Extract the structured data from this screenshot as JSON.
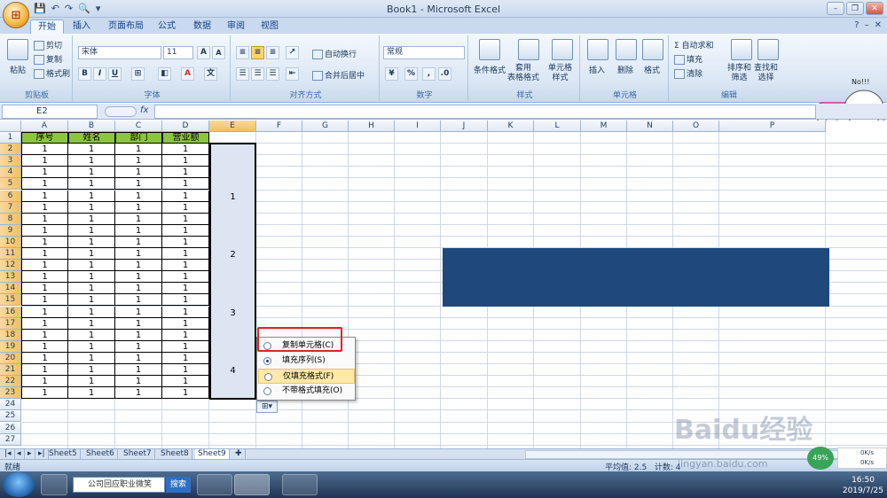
{
  "app": {
    "title": "Book1 - Microsoft Excel",
    "office_button": "⊞",
    "qat": [
      "💾",
      "↶",
      "↷",
      "🔍",
      "▾"
    ]
  },
  "ribbon_tabs": [
    "开始",
    "插入",
    "页面布局",
    "公式",
    "数据",
    "审阅",
    "视图"
  ],
  "ribbon": {
    "clipboard": {
      "paste": "粘贴",
      "cut": "剪切",
      "copy": "复制",
      "format_painter": "格式刷",
      "label": "剪贴板"
    },
    "font": {
      "name": "宋体",
      "size": "11",
      "grow": "A",
      "shrink": "A",
      "bold": "B",
      "italic": "I",
      "underline": "U",
      "label": "字体"
    },
    "alignment": {
      "wrap": "自动换行",
      "merge": "合并后居中",
      "label": "对齐方式"
    },
    "number": {
      "format": "常规",
      "percent": "%",
      "comma": ",",
      "label": "数字"
    },
    "styles": {
      "conditional": "条件格式",
      "table": "套用\n表格格式",
      "cell_styles": "单元格\n样式",
      "label": "样式"
    },
    "cells": {
      "insert": "插入",
      "delete": "删除",
      "format": "格式",
      "label": "单元格"
    },
    "editing": {
      "autosum": "Σ 自动求和",
      "fill": "填充",
      "clear": "清除",
      "sort": "排序和\n筛选",
      "find": "查找和\n选择",
      "label": "编辑"
    }
  },
  "formula_bar": {
    "name_box": "E2",
    "fx": "fx",
    "value": ""
  },
  "columns": [
    "A",
    "B",
    "C",
    "D",
    "E",
    "F",
    "G",
    "H",
    "I",
    "J",
    "K",
    "L",
    "M",
    "N",
    "O",
    "P"
  ],
  "rows": [
    "1",
    "2",
    "3",
    "4",
    "5",
    "6",
    "7",
    "8",
    "9",
    "10",
    "11",
    "12",
    "13",
    "14",
    "15",
    "16",
    "17",
    "18",
    "19",
    "20",
    "21",
    "22",
    "23",
    "24",
    "25",
    "26",
    "27"
  ],
  "table": {
    "headers": [
      "序号",
      "姓名",
      "部门",
      "营业额"
    ],
    "row_value": "1",
    "row_count": 22
  },
  "e_column_values": [
    {
      "text": "1",
      "row": 6
    },
    {
      "text": "2",
      "row": 11
    },
    {
      "text": "3",
      "row": 16
    },
    {
      "text": "4",
      "row": 21
    }
  ],
  "context_menu": {
    "items": [
      {
        "label": "复制单元格(C)",
        "selected": false,
        "hover": false
      },
      {
        "label": "填充序列(S)",
        "selected": true,
        "hover": false
      },
      {
        "label": "仅填充格式(F)",
        "selected": false,
        "hover": true
      },
      {
        "label": "不带格式填充(O)",
        "selected": false,
        "hover": false
      }
    ]
  },
  "sheets": [
    "Sheet5",
    "Sheet6",
    "Sheet7",
    "Sheet8",
    "Sheet9"
  ],
  "active_sheet": "Sheet9",
  "status": {
    "mode": "就绪",
    "average": "平均值: 2.5",
    "count": "计数: 4"
  },
  "taskbar": {
    "search_placeholder": "公司回应职业微笑",
    "search_button": "搜索",
    "time": "16:50",
    "date": "2019/7/25"
  },
  "overlays": {
    "watermark": "Baidu经验",
    "watermark_url": "jingyan.baidu.com",
    "badge": "49%",
    "net_up": "0K/s",
    "net_down": "0K/s",
    "mascot_text": "No!!!",
    "mascot_label": "中 高"
  },
  "colors": {
    "header_green": "#8cc63f",
    "selection_fill": "#dde4f2",
    "blue_rect": "#1f497d",
    "highlight_red": "#d9262a"
  }
}
